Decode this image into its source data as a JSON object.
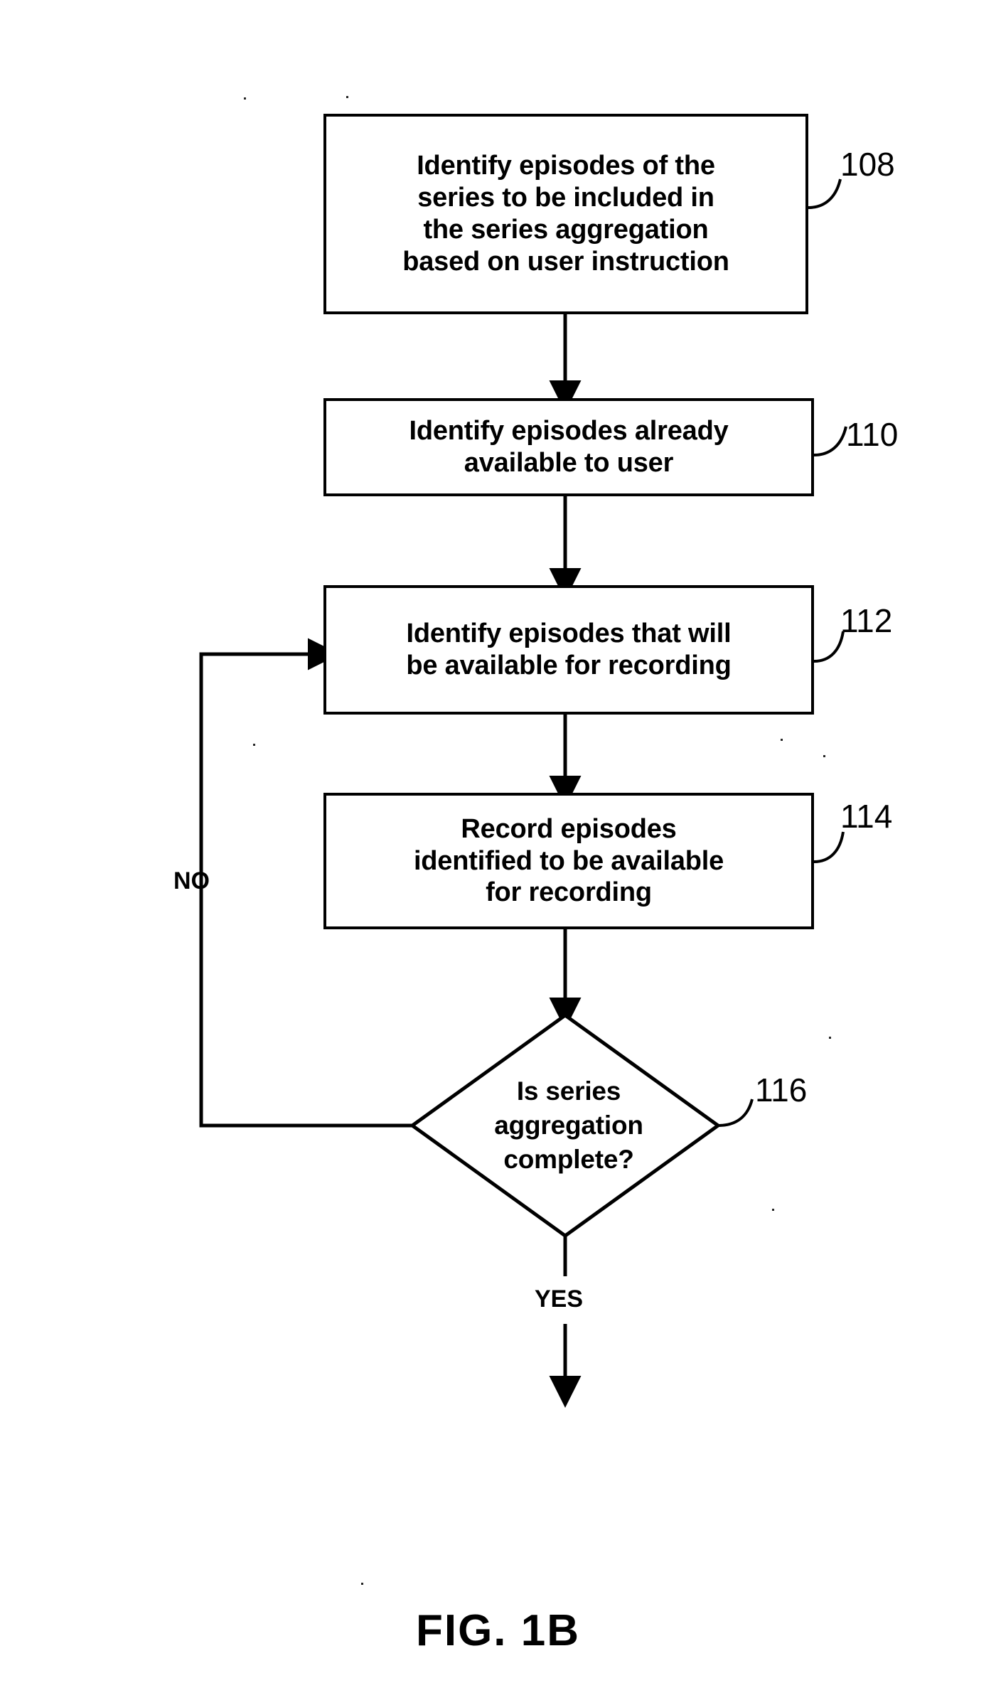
{
  "figure": {
    "caption": "FIG. 1B",
    "type": "flowchart"
  },
  "nodes": [
    {
      "id": "108",
      "shape": "process",
      "ref": "108",
      "text": "Identify episodes of the\nseries to be included in\nthe series aggregation\nbased on user instruction"
    },
    {
      "id": "110",
      "shape": "process",
      "ref": "110",
      "text": "Identify episodes already\navailable to user"
    },
    {
      "id": "112",
      "shape": "process",
      "ref": "112",
      "text": "Identify episodes that will\nbe available for recording"
    },
    {
      "id": "114",
      "shape": "process",
      "ref": "114",
      "text": "Record episodes\nidentified to be available\nfor recording"
    },
    {
      "id": "116",
      "shape": "decision",
      "ref": "116",
      "text": "Is series\naggregation\ncomplete?"
    }
  ],
  "edges": [
    {
      "from": "108",
      "to": "110",
      "label": ""
    },
    {
      "from": "110",
      "to": "112",
      "label": ""
    },
    {
      "from": "112",
      "to": "114",
      "label": ""
    },
    {
      "from": "114",
      "to": "116",
      "label": ""
    },
    {
      "from": "116",
      "to": "112",
      "label": "NO"
    },
    {
      "from": "116",
      "to": "exit",
      "label": "YES"
    }
  ],
  "labels": {
    "no": "NO",
    "yes": "YES"
  },
  "colors": {
    "stroke": "#000000",
    "fill": "#ffffff",
    "text": "#000000"
  }
}
